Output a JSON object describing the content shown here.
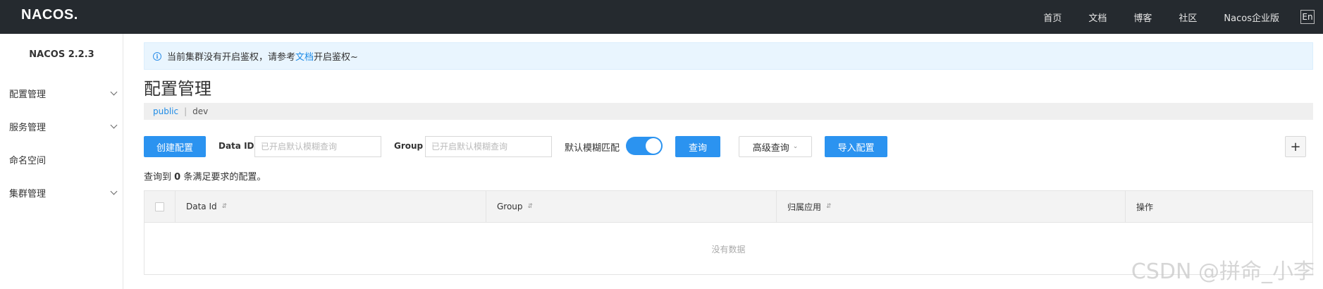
{
  "header": {
    "logo": "NACOS.",
    "nav": [
      "首页",
      "文档",
      "博客",
      "社区",
      "Nacos企业版"
    ],
    "lang": "En"
  },
  "sidebar": {
    "version": "NACOS 2.2.3",
    "items": [
      {
        "label": "配置管理",
        "expandable": true
      },
      {
        "label": "服务管理",
        "expandable": true
      },
      {
        "label": "命名空间",
        "expandable": false
      },
      {
        "label": "集群管理",
        "expandable": true
      }
    ]
  },
  "alert": {
    "prefix": "当前集群没有开启鉴权，请参考",
    "link": "文档",
    "suffix": "开启鉴权~"
  },
  "page": {
    "title": "配置管理",
    "namespaces": {
      "active": "public",
      "separator": "|",
      "other": "dev"
    }
  },
  "toolbar": {
    "create_label": "创建配置",
    "dataid_label": "Data ID",
    "dataid_placeholder": "已开启默认模糊查询",
    "group_label": "Group",
    "group_placeholder": "已开启默认模糊查询",
    "fuzzy_label": "默认模糊匹配",
    "fuzzy_on": true,
    "query_label": "查询",
    "advanced_label": "高级查询",
    "import_label": "导入配置",
    "add_symbol": "+"
  },
  "result": {
    "prefix": "查询到",
    "count": "0",
    "suffix": "条满足要求的配置。"
  },
  "table": {
    "columns": [
      "Data Id",
      "Group",
      "归属应用",
      "操作"
    ],
    "empty": "没有数据"
  },
  "watermark": "CSDN @拼命_小李",
  "colors": {
    "topbar": "#252a2f",
    "primary": "#2b93f0",
    "alert_bg": "#e9f5fe"
  }
}
